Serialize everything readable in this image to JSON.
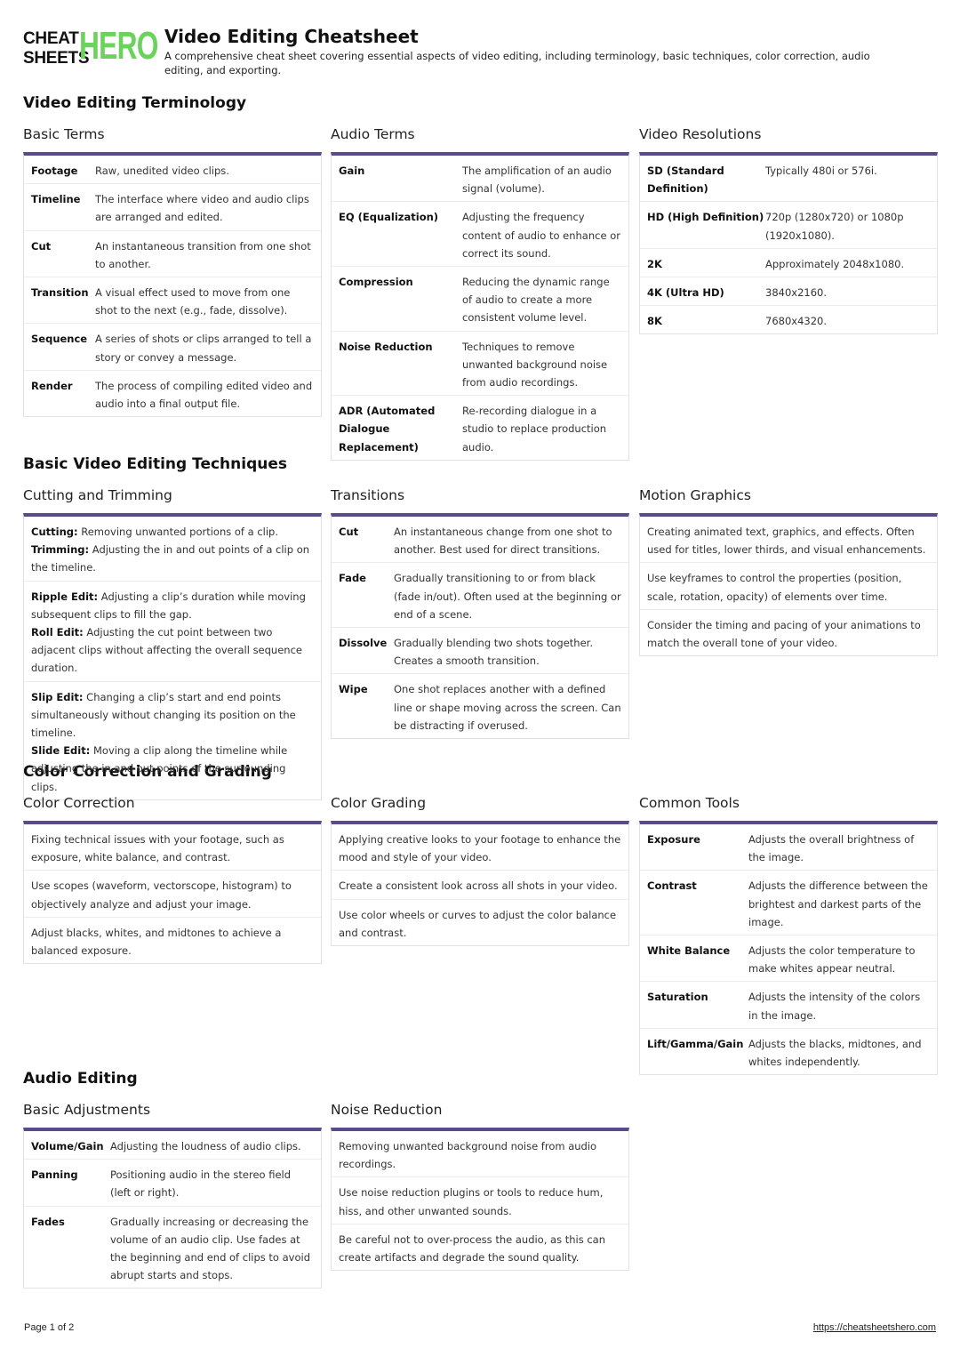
{
  "logo": {
    "line1": "CHEAT",
    "line2": "SHEETS",
    "hero": "HERO"
  },
  "header": {
    "title": "Video Editing Cheatsheet",
    "description": "A comprehensive cheat sheet covering essential aspects of video editing, including terminology, basic techniques, color correction, audio editing, and exporting."
  },
  "sections": {
    "terminology": "Video Editing Terminology",
    "techniques": "Basic Video Editing Techniques",
    "color": "Color Correction and Grading",
    "audio": "Audio Editing"
  },
  "basic_terms": {
    "title": "Basic Terms",
    "rows": [
      {
        "k": "Footage",
        "v": "Raw, unedited video clips."
      },
      {
        "k": "Timeline",
        "v": "The interface where video and audio clips are arranged and edited."
      },
      {
        "k": "Cut",
        "v": "An instantaneous transition from one shot to another."
      },
      {
        "k": "Transition",
        "v": "A visual effect used to move from one shot to the next (e.g., fade, dissolve)."
      },
      {
        "k": "Sequence",
        "v": "A series of shots or clips arranged to tell a story or convey a message."
      },
      {
        "k": "Render",
        "v": "The process of compiling edited video and audio into a final output file."
      }
    ]
  },
  "audio_terms": {
    "title": "Audio Terms",
    "rows": [
      {
        "k": "Gain",
        "v": "The amplification of an audio signal (volume)."
      },
      {
        "k": "EQ (Equalization)",
        "v": "Adjusting the frequency content of audio to enhance or correct its sound."
      },
      {
        "k": "Compression",
        "v": "Reducing the dynamic range of audio to create a more consistent volume level."
      },
      {
        "k": "Noise Reduction",
        "v": "Techniques to remove unwanted background noise from audio recordings."
      },
      {
        "k": "ADR (Automated Dialogue Replacement)",
        "v": "Re-recording dialogue in a studio to replace production audio."
      }
    ]
  },
  "video_resolutions": {
    "title": "Video Resolutions",
    "rows": [
      {
        "k": "SD (Standard Definition)",
        "v": "Typically 480i or 576i."
      },
      {
        "k": "HD (High Definition)",
        "v": "720p (1280x720) or 1080p (1920x1080)."
      },
      {
        "k": "2K",
        "v": "Approximately 2048x1080."
      },
      {
        "k": "4K (Ultra HD)",
        "v": "3840x2160."
      },
      {
        "k": "8K",
        "v": "7680x4320."
      }
    ]
  },
  "cutting": {
    "title": "Cutting and Trimming",
    "blocks": [
      [
        {
          "k": "Cutting:",
          "v": " Removing unwanted portions of a clip."
        },
        {
          "k": "Trimming:",
          "v": " Adjusting the in and out points of a clip on the timeline."
        }
      ],
      [
        {
          "k": "Ripple Edit:",
          "v": " Adjusting a clip’s duration while moving subsequent clips to fill the gap."
        },
        {
          "k": "Roll Edit:",
          "v": " Adjusting the cut point between two adjacent clips without affecting the overall sequence duration."
        }
      ],
      [
        {
          "k": "Slip Edit:",
          "v": " Changing a clip’s start and end points simultaneously without changing its position on the timeline."
        },
        {
          "k": "Slide Edit:",
          "v": " Moving a clip along the timeline while adjusting the in and out points of the surrounding clips."
        }
      ]
    ]
  },
  "transitions": {
    "title": "Transitions",
    "rows": [
      {
        "k": "Cut",
        "v": "An instantaneous change from one shot to another. Best used for direct transitions."
      },
      {
        "k": "Fade",
        "v": "Gradually transitioning to or from black (fade in/out). Often used at the beginning or end of a scene."
      },
      {
        "k": "Dissolve",
        "v": "Gradually blending two shots together. Creates a smooth transition."
      },
      {
        "k": "Wipe",
        "v": "One shot replaces another with a defined line or shape moving across the screen. Can be distracting if overused."
      }
    ]
  },
  "motion_graphics": {
    "title": "Motion Graphics",
    "items": [
      "Creating animated text, graphics, and effects. Often used for titles, lower thirds, and visual enhancements.",
      "Use keyframes to control the properties (position, scale, rotation, opacity) of elements over time.",
      "Consider the timing and pacing of your animations to match the overall tone of your video."
    ]
  },
  "color_correction": {
    "title": "Color Correction",
    "items": [
      "Fixing technical issues with your footage, such as exposure, white balance, and contrast.",
      "Use scopes (waveform, vectorscope, histogram) to objectively analyze and adjust your image.",
      "Adjust blacks, whites, and midtones to achieve a balanced exposure."
    ]
  },
  "color_grading": {
    "title": "Color Grading",
    "items": [
      "Applying creative looks to your footage to enhance the mood and style of your video.",
      "Create a consistent look across all shots in your video.",
      "Use color wheels or curves to adjust the color balance and contrast."
    ]
  },
  "common_tools": {
    "title": "Common Tools",
    "rows": [
      {
        "k": "Exposure",
        "v": "Adjusts the overall brightness of the image."
      },
      {
        "k": "Contrast",
        "v": "Adjusts the difference between the brightest and darkest parts of the image."
      },
      {
        "k": "White Balance",
        "v": "Adjusts the color temperature to make whites appear neutral."
      },
      {
        "k": "Saturation",
        "v": "Adjusts the intensity of the colors in the image."
      },
      {
        "k": "Lift/Gamma/Gain",
        "v": "Adjusts the blacks, midtones, and whites independently."
      }
    ]
  },
  "basic_adjustments": {
    "title": "Basic Adjustments",
    "rows": [
      {
        "k": "Volume/Gain",
        "v": "Adjusting the loudness of audio clips."
      },
      {
        "k": "Panning",
        "v": "Positioning audio in the stereo field (left or right)."
      },
      {
        "k": "Fades",
        "v": "Gradually increasing or decreasing the volume of an audio clip. Use fades at the beginning and end of clips to avoid abrupt starts and stops."
      }
    ]
  },
  "noise_reduction": {
    "title": "Noise Reduction",
    "items": [
      "Removing unwanted background noise from audio recordings.",
      "Use noise reduction plugins or tools to reduce hum, hiss, and other unwanted sounds.",
      "Be careful not to over-process the audio, as this can create artifacts and degrade the sound quality."
    ]
  },
  "footer": {
    "page": "Page 1 of 2",
    "url": "https://cheatsheetshero.com"
  },
  "colors": {
    "accent": "#5b4a8b",
    "logo_green": "#6bd35b"
  }
}
